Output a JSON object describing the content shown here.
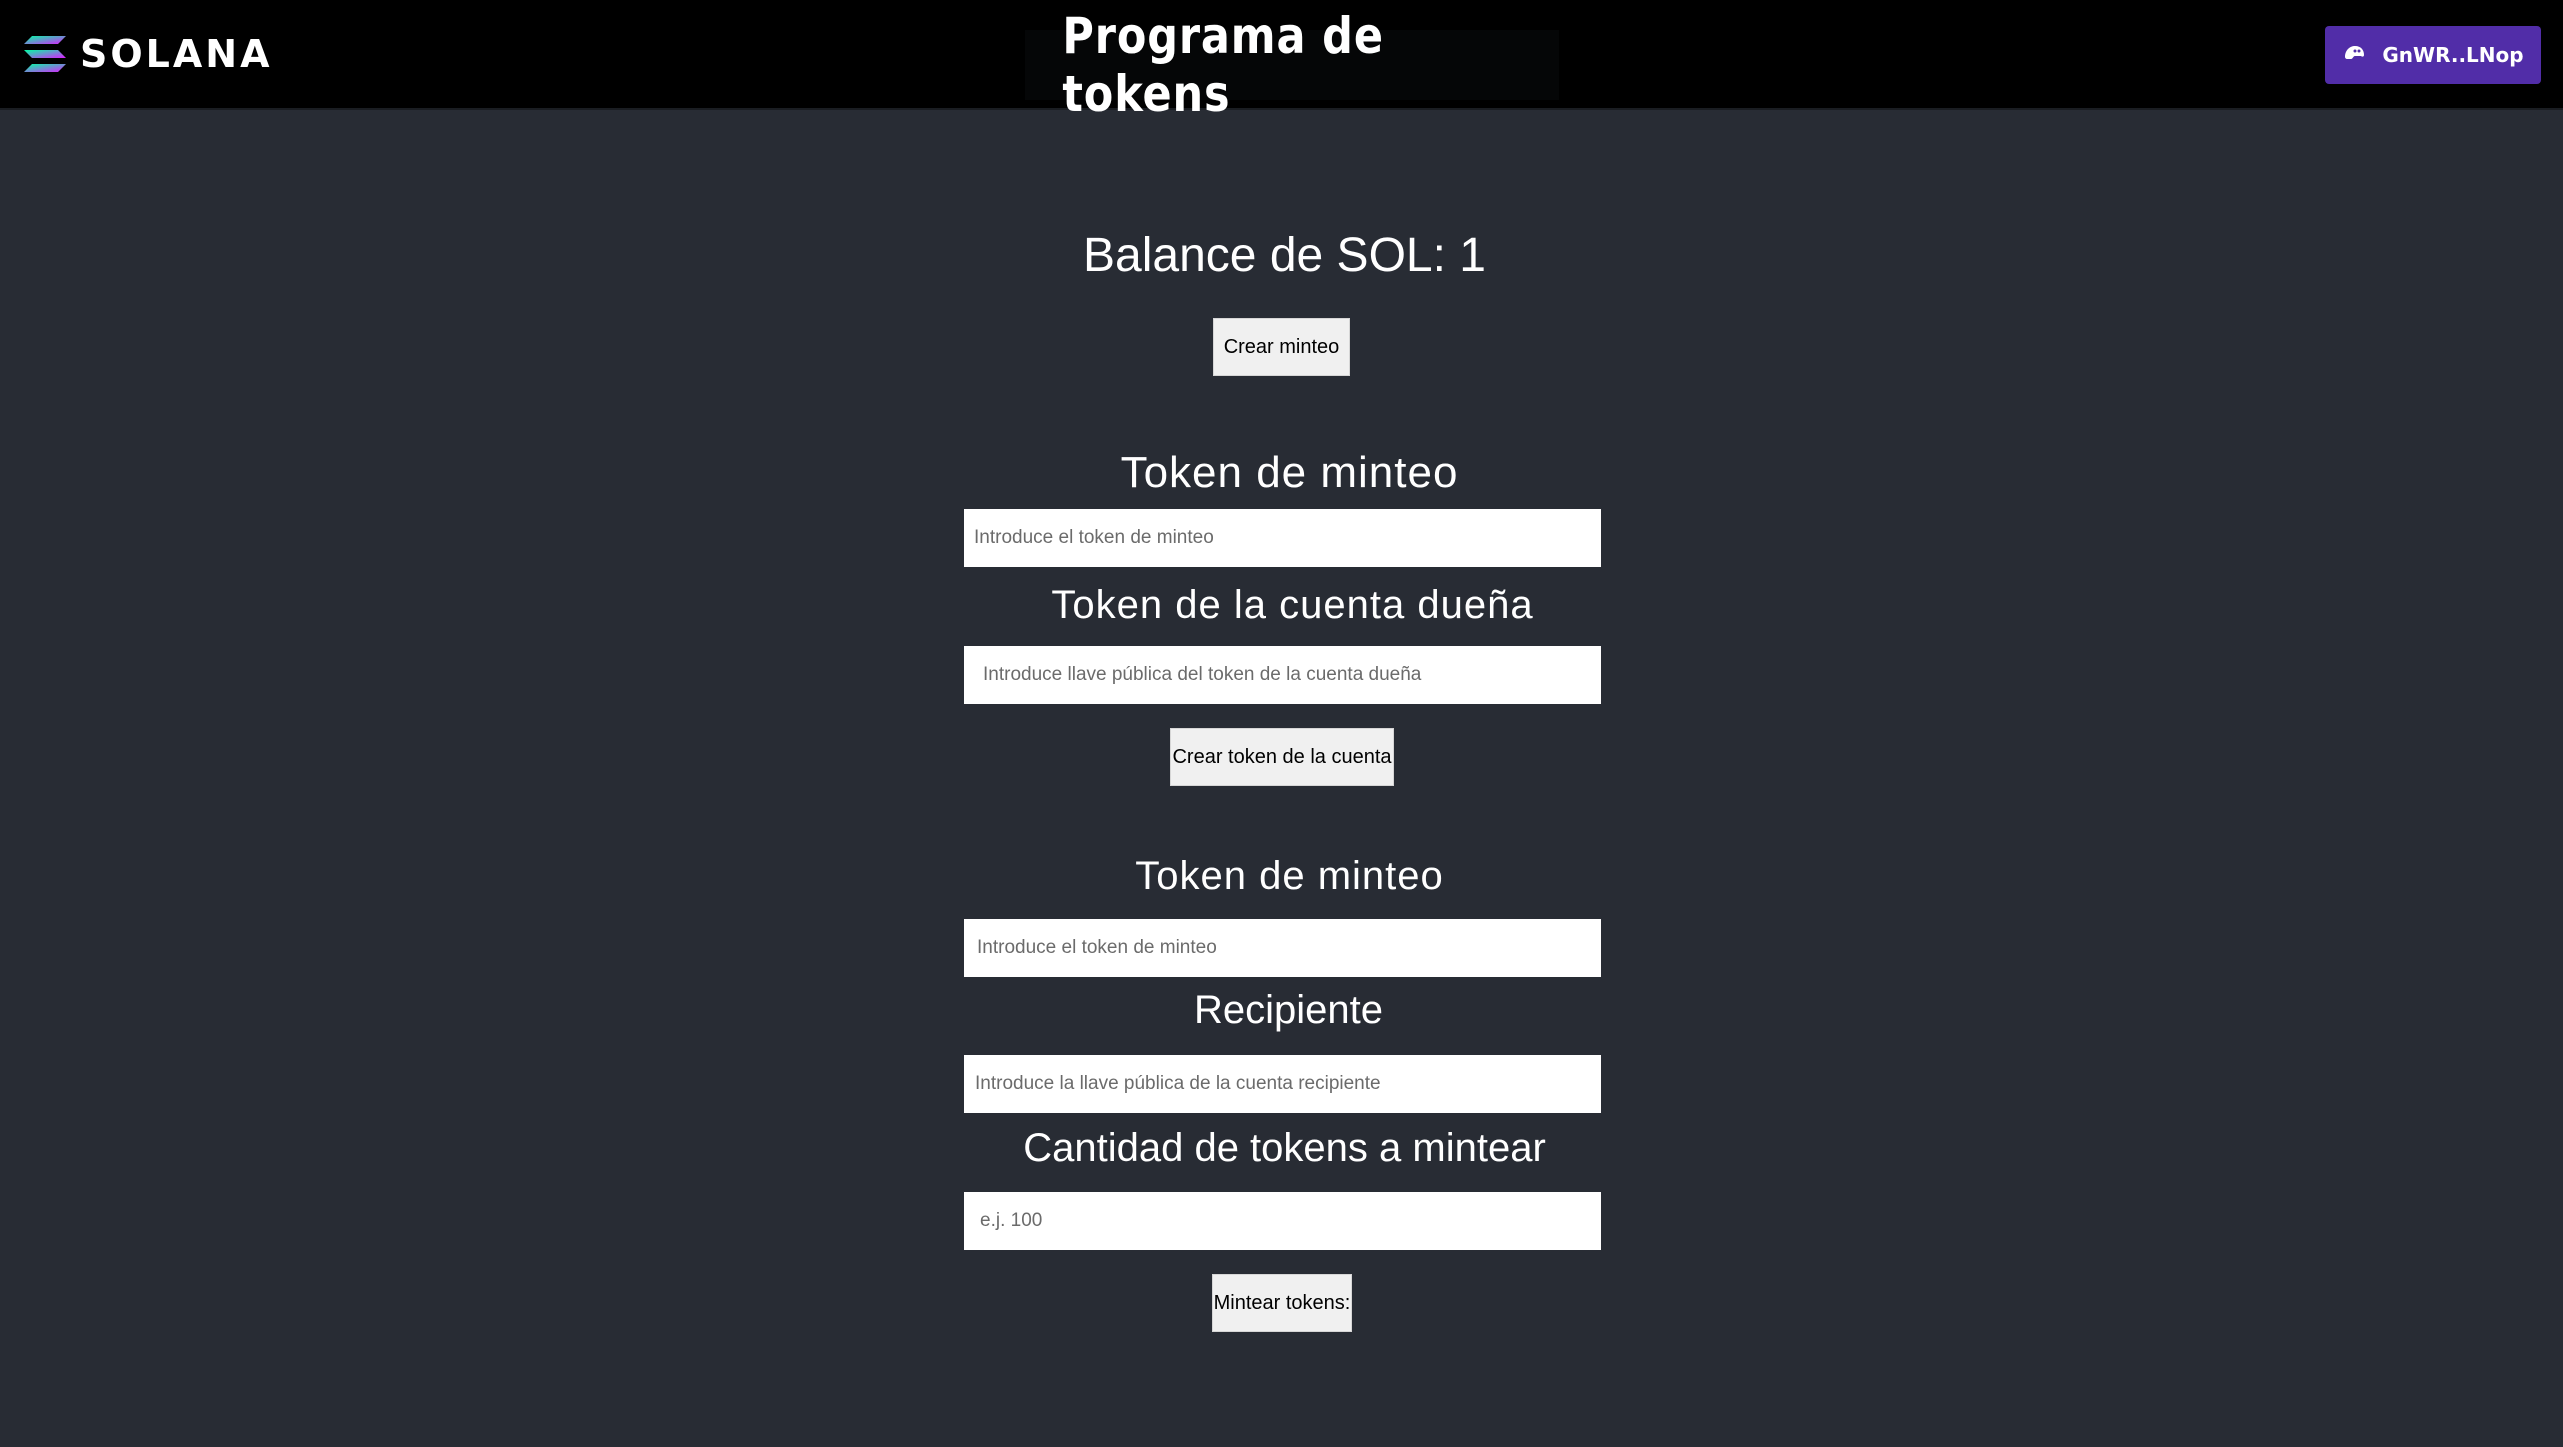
{
  "brand": {
    "logo_text": "SOLANA",
    "logo_icon": "solana-logo-icon"
  },
  "header": {
    "title": "Programa de tokens"
  },
  "wallet": {
    "label": "GnWR..LNop",
    "icon": "phantom-wallet-icon",
    "color": "#512da8"
  },
  "balance": {
    "label": "Balance de SOL: 1"
  },
  "create_mint": {
    "button_label": "Crear minteo"
  },
  "create_account": {
    "mint_heading": "Token de minteo",
    "mint_placeholder": "Introduce el token de minteo",
    "owner_heading": "Token de la cuenta dueña",
    "owner_placeholder": "Introduce llave pública del token de la cuenta dueña",
    "button_label": "Crear token de la cuenta"
  },
  "mint_tokens": {
    "mint_heading": "Token de minteo",
    "mint_placeholder": "Introduce el token de minteo",
    "recipient_heading": "Recipiente",
    "recipient_placeholder": "Introduce la llave pública de la cuenta recipiente",
    "amount_heading": "Cantidad de tokens a mintear",
    "amount_placeholder": "e.j. 100",
    "button_label": "Mintear tokens:"
  },
  "colors": {
    "background": "#282c34",
    "topbar": "#000000",
    "wallet_button": "#512da8"
  }
}
